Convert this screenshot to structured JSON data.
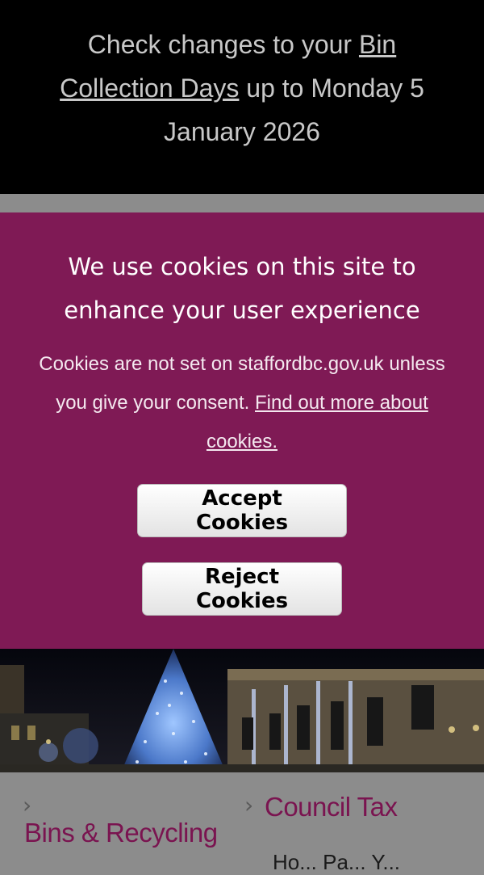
{
  "notice": {
    "text_before": "Check changes to your ",
    "link": "Bin Collection Days",
    "text_after": " up to Monday 5 January 2026"
  },
  "cookie_banner": {
    "title": "We use cookies on this site to enhance your user experience",
    "body": "Cookies are not set on staffordbc.gov.uk unless you give your consent. ",
    "link": "Find out more about cookies.",
    "accept_label": "Accept Cookies",
    "reject_label": "Reject Cookies"
  },
  "services": [
    {
      "label": "Bins & Recycling",
      "icon": "chevron-right-icon"
    },
    {
      "label": "Council Tax",
      "icon": "chevron-right-icon"
    }
  ],
  "partial_text": "Ho... Pa... Y...",
  "colors": {
    "brand": "#7f1a55",
    "link": "#7a1450",
    "banner_bg": "#000000",
    "page_bg": "#8c8c8c"
  }
}
